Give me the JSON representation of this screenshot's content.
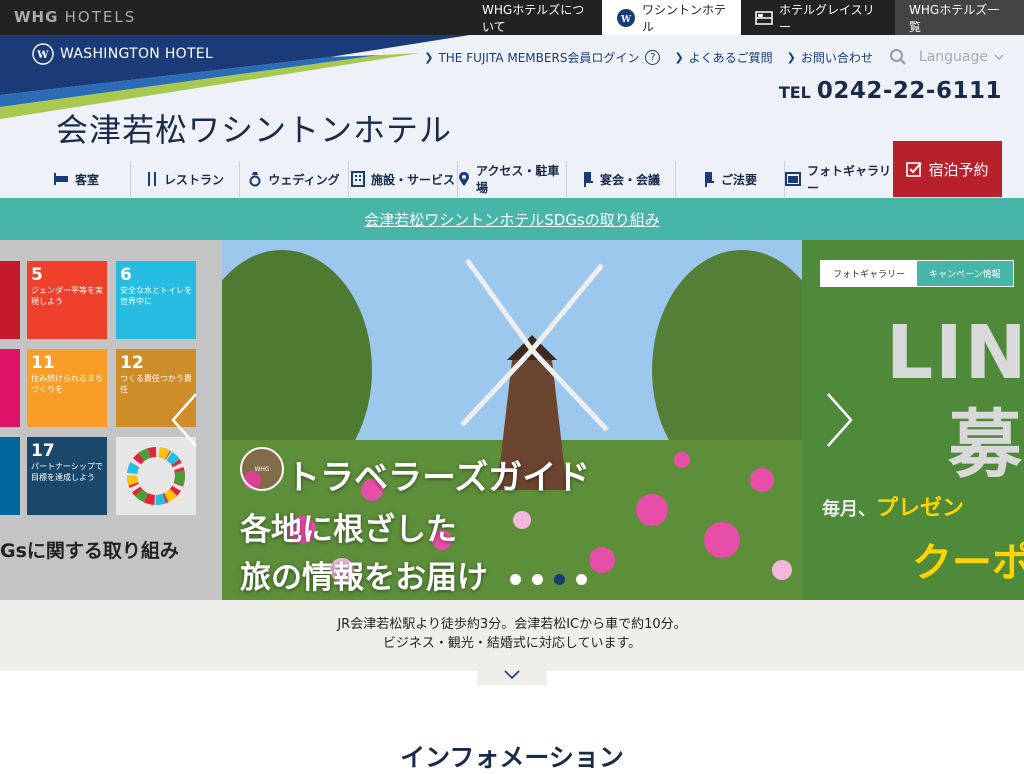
{
  "topbar": {
    "brand_mark": "WHG",
    "brand_text": "HOTELS",
    "nav": [
      {
        "label": "WHGホテルズについて"
      },
      {
        "label": "ワシントンホテル"
      },
      {
        "label": "ホテルグレイスリー"
      },
      {
        "label": "WHGホテルズ一覧"
      }
    ]
  },
  "header": {
    "logo_text": "WASHINGTON HOTEL",
    "hotel_name": "会津若松ワシントンホテル",
    "util_links": [
      {
        "label": "THE FUJITA MEMBERS会員ログイン"
      },
      {
        "label": "よくあるご質問"
      },
      {
        "label": "お問い合わせ"
      }
    ],
    "language_label": "Language",
    "tel_label": "TEL",
    "tel_number": "0242-22-6111"
  },
  "main_nav": [
    {
      "label": "客室",
      "icon": "bed-icon"
    },
    {
      "label": "レストラン",
      "icon": "fork-knife-icon"
    },
    {
      "label": "ウェディング",
      "icon": "ring-icon"
    },
    {
      "label": "施設・サービス",
      "icon": "building-icon"
    },
    {
      "label": "アクセス・駐車場",
      "icon": "map-pin-icon"
    },
    {
      "label": "宴会・会議",
      "icon": "chair-icon"
    },
    {
      "label": "ご法要",
      "icon": "chair-icon"
    },
    {
      "label": "フォトギャラリー",
      "icon": "photo-icon"
    }
  ],
  "reserve_label": "宿泊予約",
  "sdgs_link": "会津若松ワシントンホテルSDGsの取り組み",
  "slider": {
    "left": {
      "tiles": [
        {
          "num": "5",
          "text": "ジェンダー平等を実現しよう",
          "color": "#ef402c"
        },
        {
          "num": "6",
          "text": "安全な水とトイレを世界中に",
          "color": "#27bde2"
        },
        {
          "num": "11",
          "text": "住み続けられるまちづくりを",
          "color": "#f99d26"
        },
        {
          "num": "12",
          "text": "つくる責任つかう責任",
          "color": "#cf8d2a"
        },
        {
          "num": "17",
          "text": "パートナーシップで目標を達成しよう",
          "color": "#19486a"
        }
      ],
      "caption": "Gsに関する取り組み"
    },
    "main": {
      "line1": "トラベラーズガイド",
      "line2": "各地に根ざした",
      "line3": "旅の情報をお届け"
    },
    "right": {
      "tabs": [
        "フォトギャラリー",
        "キャンペーン情報"
      ],
      "big1": "LINE",
      "big2": "募",
      "line3_a": "毎月、",
      "line3_b": "プレゼン",
      "line4": "クーポ"
    },
    "dots_total": 4,
    "dot_active": 2
  },
  "intro": {
    "line1": "JR会津若松駅より徒歩約3分。会津若松ICから車で約10分。",
    "line2": "ビジネス・観光・結婚式に対応しています。"
  },
  "info_title": "インフォメーション",
  "colors": {
    "navy": "#1a2a4a",
    "teal": "#48b5a9",
    "reserve_red": "#b8202c"
  }
}
